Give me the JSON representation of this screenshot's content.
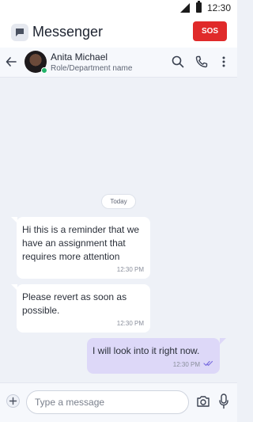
{
  "status_bar": {
    "time": "12:30"
  },
  "app_bar": {
    "title": "Messenger",
    "sos_label": "SOS"
  },
  "contact": {
    "name": "Anita Michael",
    "role": "Role/Department name",
    "status": "online"
  },
  "date_separator": "Today",
  "messages": [
    {
      "direction": "incoming",
      "text": "Hi this is a reminder that we have an assignment that requires more attention",
      "time": "12:30 PM"
    },
    {
      "direction": "incoming",
      "text": "Please revert as soon as possible.",
      "time": "12:30 PM"
    },
    {
      "direction": "outgoing",
      "text": "I will look into it right now.",
      "time": "12:30 PM",
      "read": true
    }
  ],
  "composer": {
    "placeholder": "Type a message"
  },
  "colors": {
    "sos": "#e02a2a",
    "outgoing_bubble": "#ddd8f8",
    "incoming_bubble": "#ffffff",
    "read_ticks": "#7b6ee0",
    "online": "#23b36a",
    "background": "#eef1f7"
  }
}
